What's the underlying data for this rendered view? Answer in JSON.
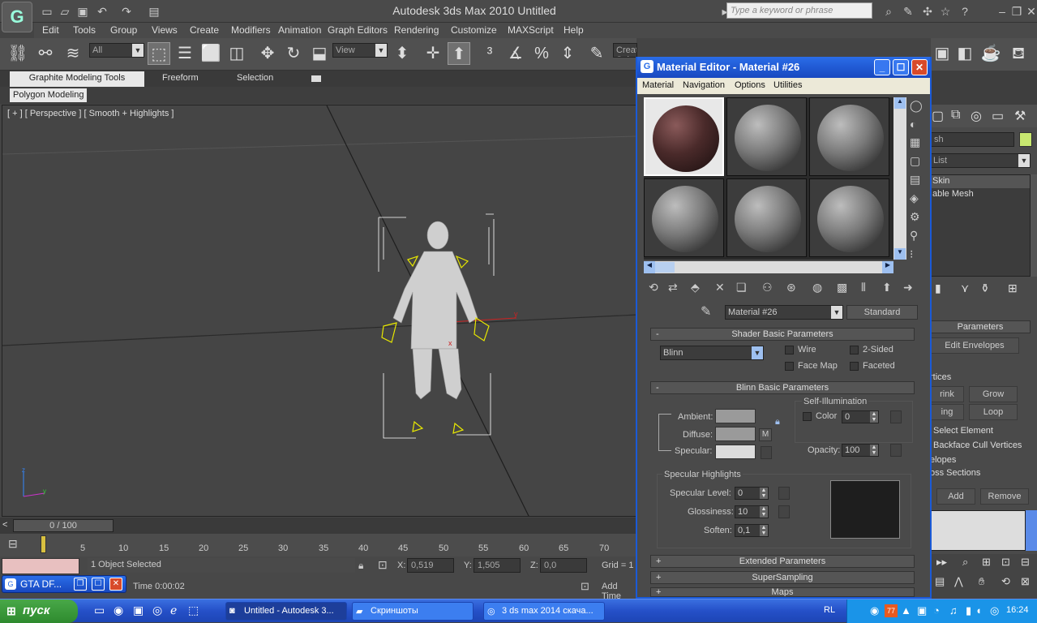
{
  "window": {
    "title": "Autodesk 3ds Max  2010      Untitled",
    "search_placeholder": "Type a keyword or phrase"
  },
  "menu": [
    "Edit",
    "Tools",
    "Group",
    "Views",
    "Create",
    "Modifiers",
    "Animation",
    "Graph Editors",
    "Rendering",
    "Customize",
    "MAXScript",
    "Help"
  ],
  "toolbar": {
    "filter": "All",
    "view": "View",
    "selection_set": "Create Selection Se"
  },
  "ribbon": {
    "tabs": [
      "Graphite Modeling Tools",
      "Freeform",
      "Selection"
    ],
    "sub": "Polygon Modeling"
  },
  "viewport": {
    "label": "[ + ] [ Perspective ] [ Smooth + Highlights ]"
  },
  "timeline": {
    "frame": "0 / 100",
    "ticks": [
      "5",
      "10",
      "15",
      "20",
      "25",
      "30",
      "35",
      "40",
      "45",
      "50",
      "55",
      "60",
      "65",
      "70"
    ]
  },
  "status": {
    "selected": "1 Object Selected",
    "x": "0,519",
    "y": "1,505",
    "z": "0,0",
    "grid": "Grid = 1",
    "time": "Time  0:00:02",
    "add_time": "Add Time",
    "x_lbl": "X:",
    "y_lbl": "Y:",
    "z_lbl": "Z:"
  },
  "material_editor": {
    "title": "Material Editor - Material #26",
    "menu": [
      "Material",
      "Navigation",
      "Options",
      "Utilities"
    ],
    "material_name": "Material #26",
    "material_type": "Standard",
    "shader_rollout": "Shader Basic Parameters",
    "shader": "Blinn",
    "wire": "Wire",
    "two_sided": "2-Sided",
    "face_map": "Face Map",
    "faceted": "Faceted",
    "blinn_rollout": "Blinn Basic Parameters",
    "ambient": "Ambient:",
    "diffuse": "Diffuse:",
    "specular": "Specular:",
    "self_illum": "Self-Illumination",
    "color_lbl": "Color",
    "color_val": "0",
    "opacity_lbl": "Opacity:",
    "opacity_val": "100",
    "spec_highlights": "Specular Highlights",
    "spec_level_lbl": "Specular Level:",
    "spec_level": "0",
    "gloss_lbl": "Glossiness:",
    "gloss": "10",
    "soften_lbl": "Soften:",
    "soften": "0,1",
    "m_btn": "M",
    "rollouts": [
      "Extended Parameters",
      "SuperSampling",
      "Maps"
    ]
  },
  "command_panel": {
    "name_field": "sh",
    "modifier_list": "List",
    "stack": [
      "Skin",
      "able Mesh"
    ],
    "parameters": "Parameters",
    "edit_envelopes": "Edit Envelopes",
    "vertices": "rtices",
    "shrink": "rink",
    "grow": "Grow",
    "ring": "ing",
    "loop": "Loop",
    "select_element": "Select Element",
    "backface": "Backface Cull Vertices",
    "envelopes": "elopes",
    "cross": "oss Sections",
    "add": "Add",
    "remove": "Remove"
  },
  "taskbar": {
    "start": "пуск",
    "tasks": [
      "Untitled - Autodesk 3...",
      "Скриншоты",
      "3 ds max 2014 скача..."
    ],
    "lang": "RL",
    "clock": "16:24",
    "tray_badge": "77"
  },
  "floating": {
    "gta": "GTA DF..."
  },
  "colors": {
    "accent": "#2a6de8",
    "viewport": "#454545",
    "selection": "#e8e800"
  }
}
